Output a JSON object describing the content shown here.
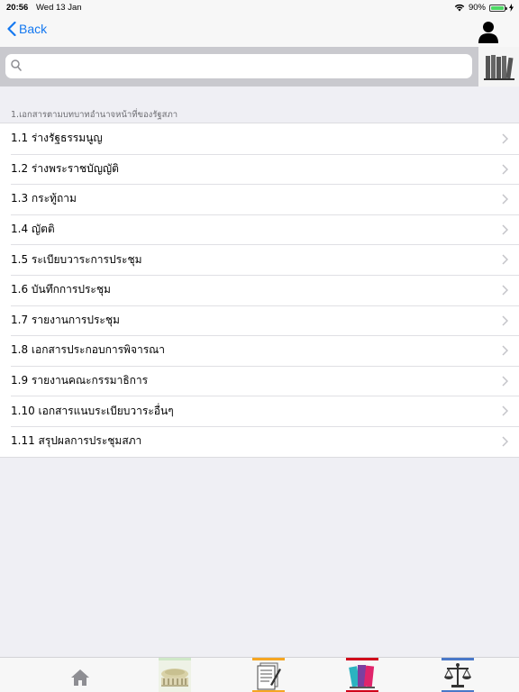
{
  "status_bar": {
    "time": "20:56",
    "date": "Wed 13 Jan",
    "battery": "90%"
  },
  "nav": {
    "back_label": "Back"
  },
  "search": {
    "placeholder": ""
  },
  "section": {
    "header": "1.เอกสารตามบทบาทอำนาจหน้าที่ของรัฐสภา",
    "items": [
      "1.1 ร่างรัฐธรรมนูญ",
      "1.2 ร่างพระราชบัญญัติ",
      "1.3 กระทู้ถาม",
      "1.4 ญัตติ",
      "1.5 ระเบียบวาระการประชุม",
      "1.6 บันทึกการประชุม",
      "1.7 รายงานการประชุม",
      "1.8 เอกสารประกอบการพิจารณา",
      "1.9 รายงานคณะกรรมาธิการ",
      "1.10 เอกสารแนบระเบียบวาระอื่นๆ",
      "1.11 สรุปผลการประชุมสภา"
    ]
  },
  "tabs": [
    "home-icon",
    "parliament-building-icon",
    "document-icon",
    "books-icon",
    "scales-icon"
  ],
  "colors": {
    "accent": "#1478f0",
    "tab_accent_green": "#a8d8a0",
    "tab_accent_orange": "#f5a623",
    "tab_accent_red": "#d0021b",
    "tab_accent_blue": "#4a78c8"
  }
}
